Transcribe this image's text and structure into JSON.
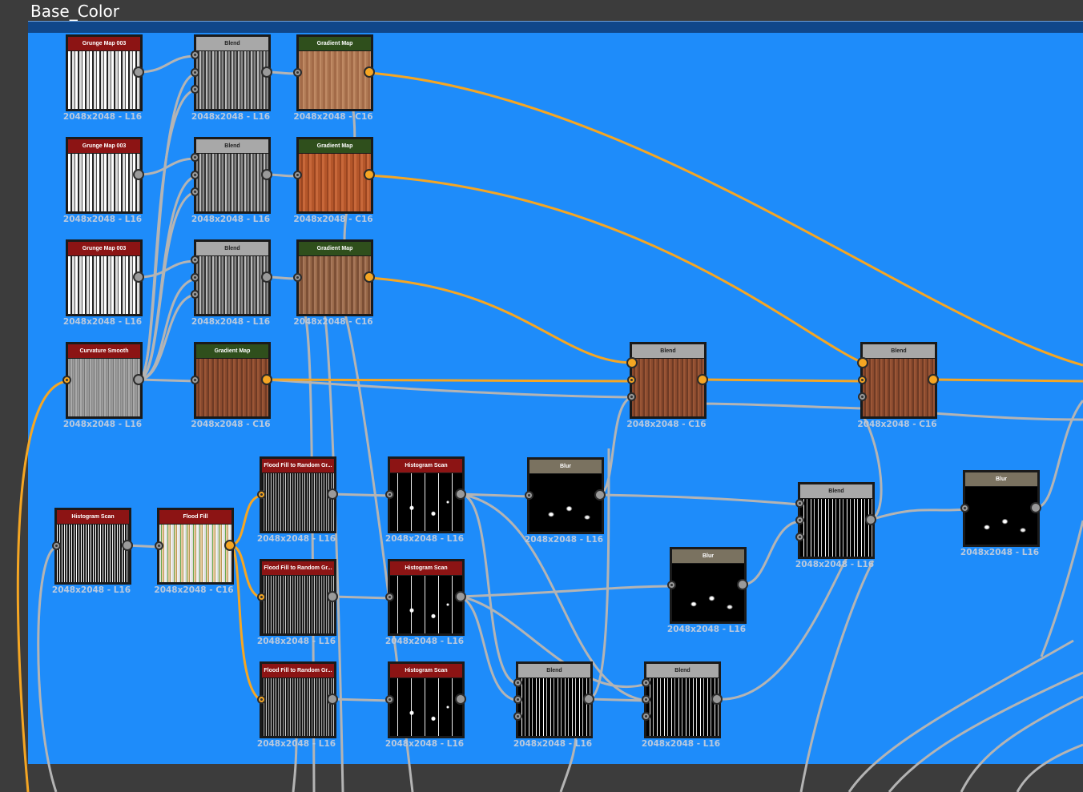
{
  "frame": {
    "title": "Base_Color",
    "background_color": "#1e8cfa",
    "header_color": "#10478a"
  },
  "wire_colors": {
    "grey": "#b4b4b4",
    "color": "#f5a623"
  },
  "nodes": [
    {
      "id": "grunge1",
      "title": "Grunge Map 003",
      "caption": "2048x2048 - L16"
    },
    {
      "id": "blend1",
      "title": "Blend",
      "caption": "2048x2048 - L16"
    },
    {
      "id": "gradmap1",
      "title": "Gradient Map",
      "caption": "2048x2048 - C16"
    },
    {
      "id": "grunge2",
      "title": "Grunge Map 003",
      "caption": "2048x2048 - L16"
    },
    {
      "id": "blend2",
      "title": "Blend",
      "caption": "2048x2048 - L16"
    },
    {
      "id": "gradmap2",
      "title": "Gradient Map",
      "caption": "2048x2048 - C16"
    },
    {
      "id": "grunge3",
      "title": "Grunge Map 003",
      "caption": "2048x2048 - L16"
    },
    {
      "id": "blend3",
      "title": "Blend",
      "caption": "2048x2048 - L16"
    },
    {
      "id": "gradmap3",
      "title": "Gradient Map",
      "caption": "2048x2048 - C16"
    },
    {
      "id": "curv",
      "title": "Curvature Smooth",
      "caption": "2048x2048 - L16"
    },
    {
      "id": "gradmap4",
      "title": "Gradient Map",
      "caption": "2048x2048 - C16"
    },
    {
      "id": "blend4",
      "title": "Blend",
      "caption": "2048x2048 - C16"
    },
    {
      "id": "blend5",
      "title": "Blend",
      "caption": "2048x2048 - C16"
    },
    {
      "id": "hist1",
      "title": "Histogram Scan",
      "caption": "2048x2048 - L16"
    },
    {
      "id": "flood",
      "title": "Flood Fill",
      "caption": "2048x2048 - C16"
    },
    {
      "id": "ffrg1",
      "title": "Flood Fill to Random Gr...",
      "caption": "2048x2048 - L16"
    },
    {
      "id": "ffrg2",
      "title": "Flood Fill to Random Gr...",
      "caption": "2048x2048 - L16"
    },
    {
      "id": "ffrg3",
      "title": "Flood Fill to Random Gr...",
      "caption": "2048x2048 - L16"
    },
    {
      "id": "hist2",
      "title": "Histogram Scan",
      "caption": "2048x2048 - L16"
    },
    {
      "id": "hist3",
      "title": "Histogram Scan",
      "caption": "2048x2048 - L16"
    },
    {
      "id": "hist4",
      "title": "Histogram Scan",
      "caption": "2048x2048 - L16"
    },
    {
      "id": "blur1",
      "title": "Blur",
      "caption": "2048x2048 - L16"
    },
    {
      "id": "blur2",
      "title": "Blur",
      "caption": "2048x2048 - L16"
    },
    {
      "id": "blur3",
      "title": "Blur",
      "caption": "2048x2048 - L16"
    },
    {
      "id": "blend6",
      "title": "Blend",
      "caption": "2048x2048 - L16"
    },
    {
      "id": "blend7",
      "title": "Blend",
      "caption": "2048x2048 - L16"
    },
    {
      "id": "blend8",
      "title": "Blend",
      "caption": "2048x2048 - L16"
    }
  ]
}
